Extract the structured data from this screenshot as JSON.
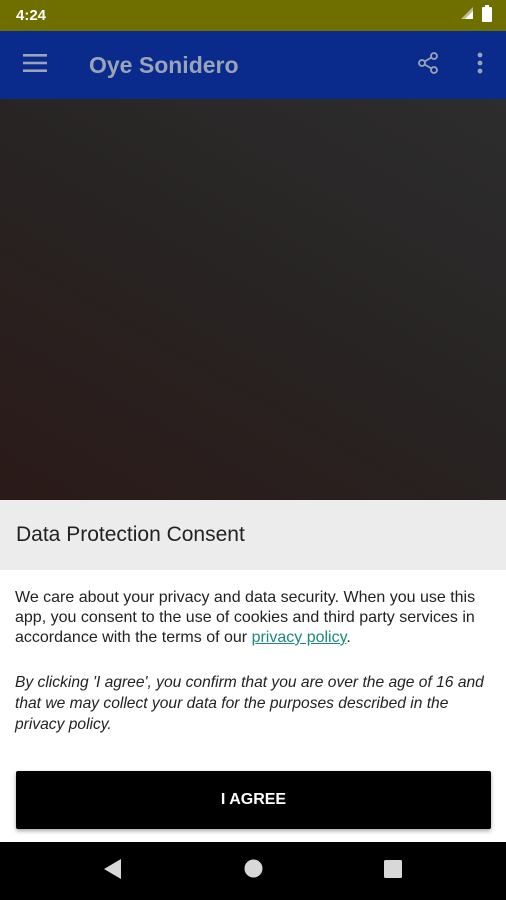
{
  "status_bar": {
    "time": "4:24",
    "icons": [
      "signal-icon",
      "battery-icon"
    ]
  },
  "app_bar": {
    "title": "Oye Sonidero",
    "color": "#0a2a8c",
    "icons": [
      "menu-icon",
      "share-icon",
      "more-vert-icon"
    ]
  },
  "consent": {
    "title": "Data Protection Consent",
    "body_prefix": "We care about your privacy and data security. When you use this app, you consent to the use of cookies and third party services in accordance with the terms of our ",
    "privacy_link": "privacy policy",
    "body_suffix": ".",
    "confirm": "By clicking 'I agree', you confirm that you are over the age of 16 and that we may collect your data for the purposes described in the privacy policy.",
    "agree_label": "I AGREE",
    "link_color": "#1a8a7a"
  },
  "nav_bar": {
    "icons": [
      "back-icon",
      "home-icon",
      "recents-icon"
    ]
  }
}
